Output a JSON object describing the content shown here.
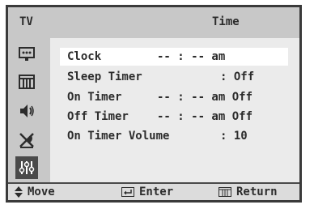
{
  "header": {
    "tv_label": "TV",
    "title": "Time"
  },
  "sidebar": {
    "icons": [
      "picture-icon",
      "sound-icon",
      "speaker-icon",
      "channel-icon",
      "setup-icon"
    ],
    "active": "setup-icon"
  },
  "menu": {
    "items": [
      {
        "label": "Clock",
        "value": "-- : -- am",
        "selected": true
      },
      {
        "label": "Sleep Timer",
        "value": ": Off",
        "selected": false
      },
      {
        "label": "On Timer",
        "value": "-- : -- am Off",
        "selected": false
      },
      {
        "label": "Off Timer",
        "value": "-- : -- am Off",
        "selected": false
      },
      {
        "label": "On Timer Volume",
        "value": ": 10",
        "selected": false
      }
    ]
  },
  "footer": {
    "move": "Move",
    "enter": "Enter",
    "return": "Return"
  },
  "colors": {
    "frame": "#3a3a3a",
    "header_bg": "#c8c8c8",
    "panel_bg": "#ebebeb",
    "selected_bg": "#ffffff",
    "text": "#2c2c2c"
  }
}
